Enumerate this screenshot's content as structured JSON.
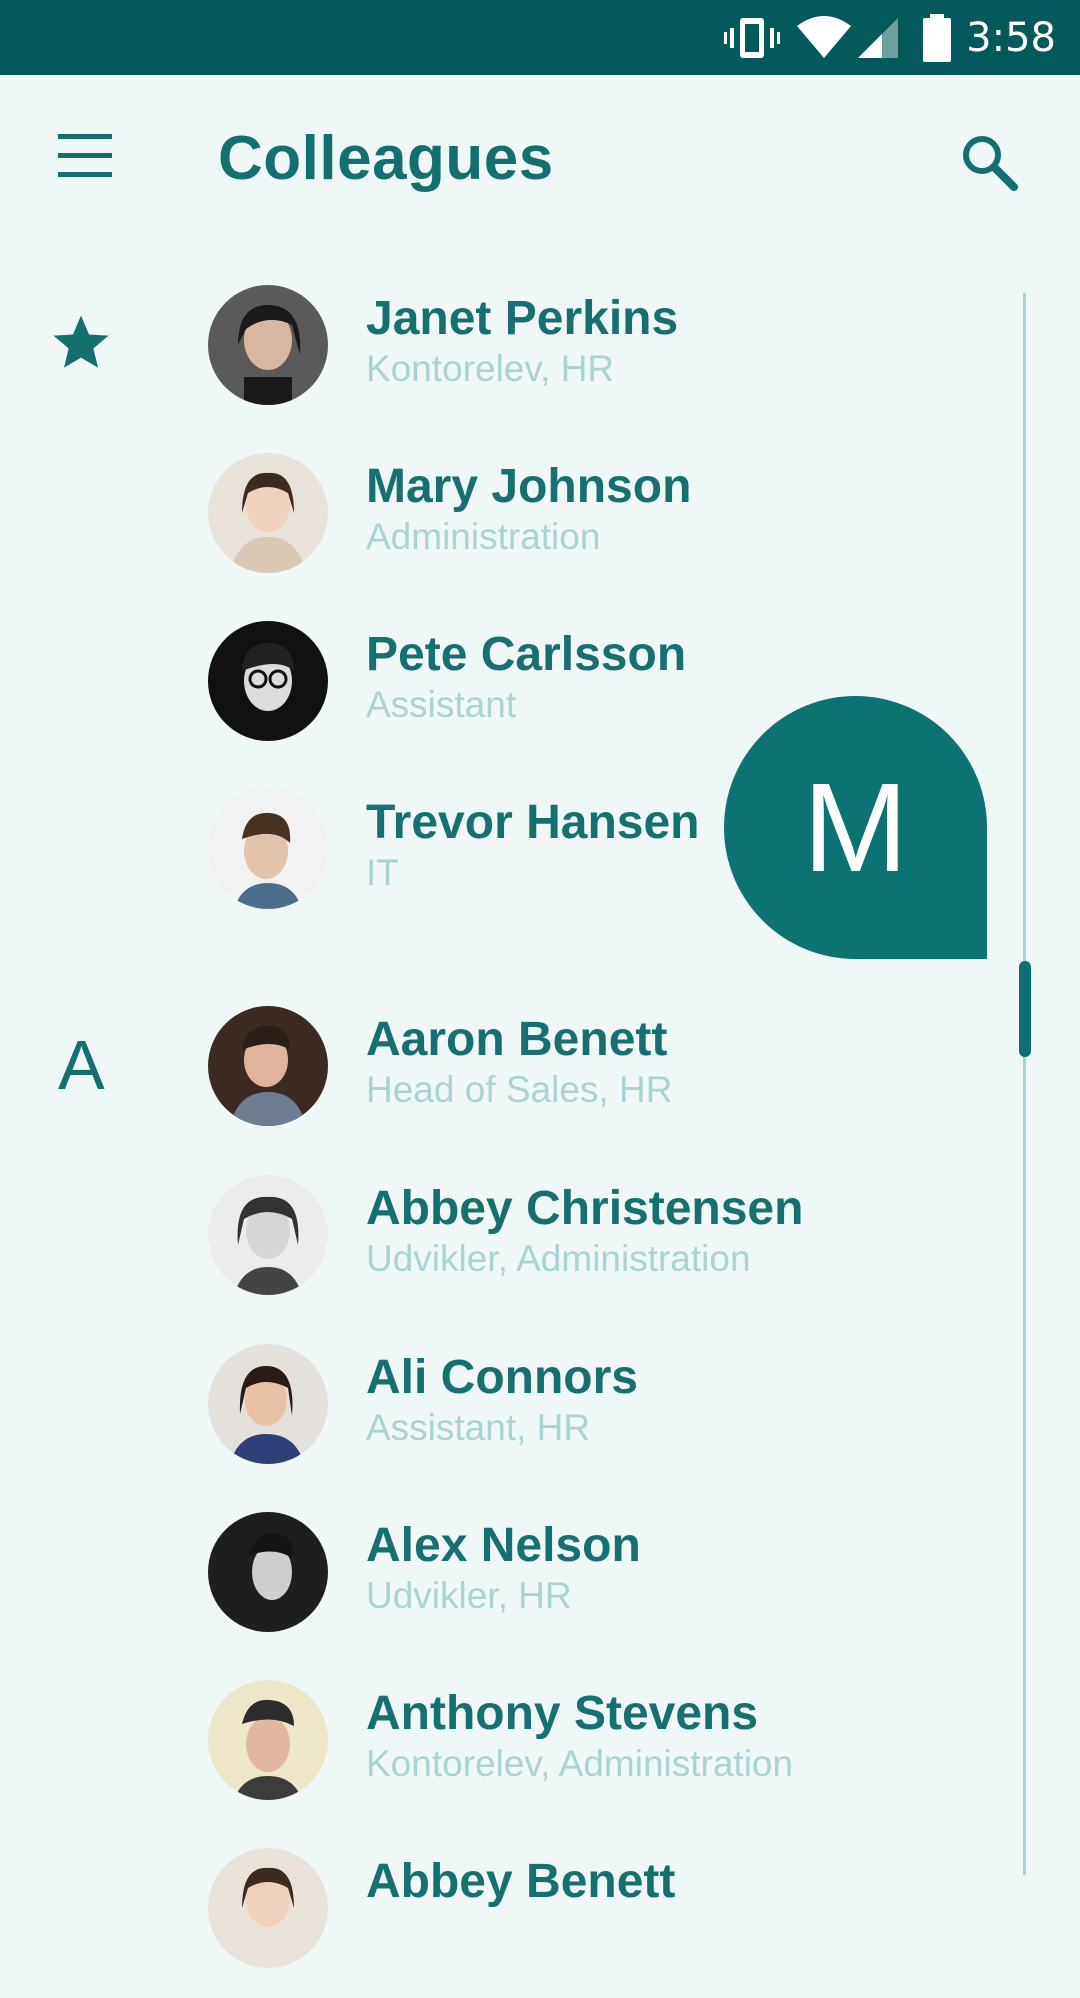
{
  "status_bar": {
    "time": "3:58",
    "icons": [
      "vibrate-icon",
      "wifi-icon",
      "cell-signal-icon",
      "battery-icon"
    ]
  },
  "app_bar": {
    "title": "Colleagues",
    "menu_icon": "menu-icon",
    "search_icon": "search-icon"
  },
  "sections": {
    "favorites_icon": "star-icon",
    "a_letter": "A"
  },
  "fast_scroll_bubble": {
    "letter": "M"
  },
  "contacts": [
    {
      "name": "Janet Perkins",
      "role": "Kontorelev, HR"
    },
    {
      "name": "Mary Johnson",
      "role": "Administration"
    },
    {
      "name": "Pete Carlsson",
      "role": "Assistant"
    },
    {
      "name": "Trevor Hansen",
      "role": "IT"
    },
    {
      "name": "Aaron Benett",
      "role": "Head of Sales, HR"
    },
    {
      "name": "Abbey Christensen",
      "role": "Udvikler, Administration"
    },
    {
      "name": "Ali Connors",
      "role": "Assistant, HR"
    },
    {
      "name": "Alex Nelson",
      "role": "Udvikler, HR"
    },
    {
      "name": "Anthony Stevens",
      "role": "Kontorelev, Administration"
    },
    {
      "name": "Abbey Benett",
      "role": ""
    }
  ],
  "colors": {
    "accent": "#13706f",
    "status_bar": "#03595c",
    "background": "#eff7f7",
    "secondary_text": "#a9d2d2"
  }
}
